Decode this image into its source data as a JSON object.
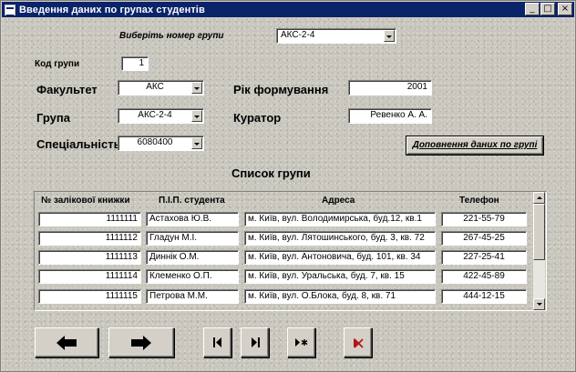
{
  "window": {
    "title": "Введення даних по групах студентів",
    "controls": {
      "minimize": "_",
      "maximize": "□",
      "close": "×"
    }
  },
  "selector": {
    "label": "Виберіть номер групи",
    "value": "АКС-2-4"
  },
  "form": {
    "code_label": "Код групи",
    "code_value": "1",
    "faculty_label": "Факультет",
    "faculty_value": "АКС",
    "group_label": "Група",
    "group_value": "АКС-2-4",
    "specialty_label": "Спеціальність",
    "specialty_value": "6080400",
    "year_label": "Рік формування",
    "year_value": "2001",
    "curator_label": "Куратор",
    "curator_value": "Ревенко А. А.",
    "supplement_button": "Доповнення даних по групі"
  },
  "list": {
    "title": "Список групи",
    "columns": [
      "№ залікової книжки",
      "П.І.П. студента",
      "Адреса",
      "Телефон"
    ],
    "rows": [
      {
        "id": "1111111",
        "name": "Астахова Ю.В.",
        "address": "м. Київ, вул. Володимирська, буд.12, кв.1",
        "phone": "221-55-79"
      },
      {
        "id": "1111112",
        "name": "Гладун М.І.",
        "address": "м. Київ, вул. Лятошинського, буд. 3, кв. 72",
        "phone": "267-45-25"
      },
      {
        "id": "1111113",
        "name": "Диннік О.М.",
        "address": "м. Київ, вул. Антоновича, буд. 101, кв. 34",
        "phone": "227-25-41"
      },
      {
        "id": "1111114",
        "name": "Клеменко О.П.",
        "address": "м. Київ, вул. Уральська, буд. 7, кв. 15",
        "phone": "422-45-89"
      },
      {
        "id": "1111115",
        "name": "Петрова М.М.",
        "address": "м. Київ, вул. О.Блока, буд. 8, кв. 71",
        "phone": "444-12-15"
      }
    ]
  },
  "nav": {
    "icons": [
      "arrow-left-icon",
      "arrow-right-icon",
      "first-record-icon",
      "last-record-icon",
      "new-record-icon",
      "delete-record-icon"
    ],
    "delete_color": "#b01818"
  }
}
